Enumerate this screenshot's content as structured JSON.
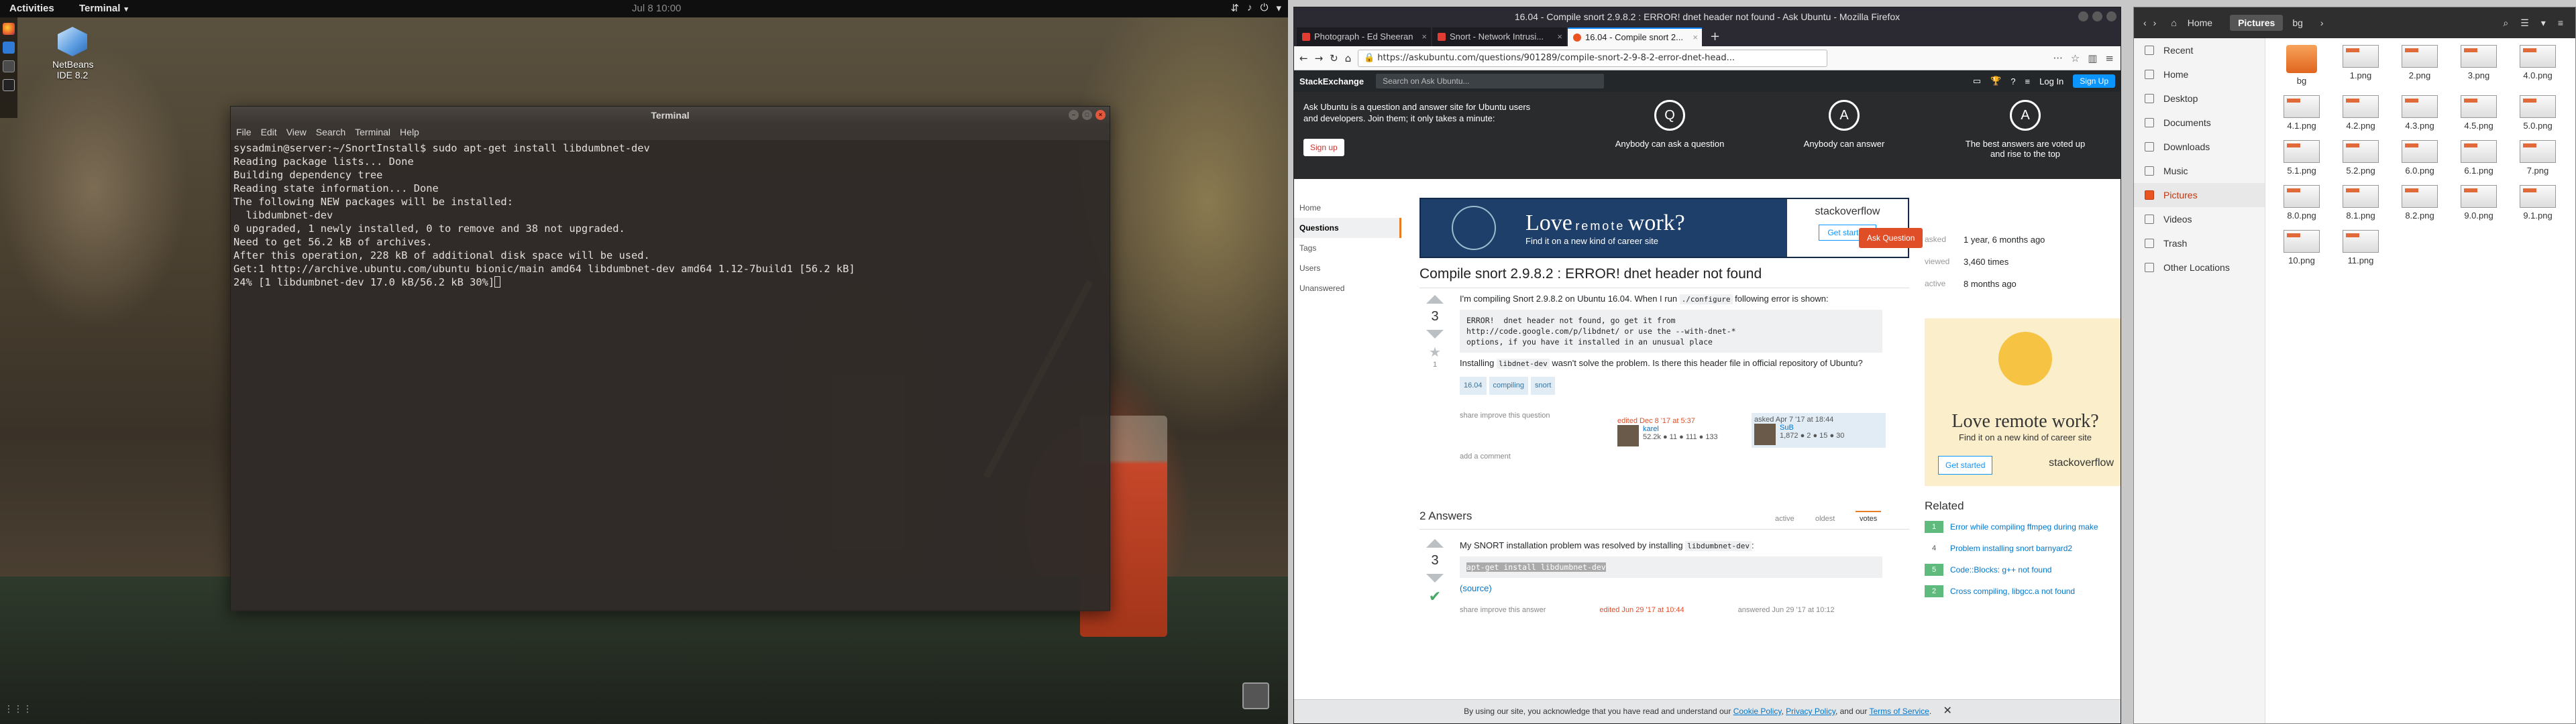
{
  "topbar": {
    "activities": "Activities",
    "app": "Terminal",
    "clock": "Jul 8 10:00"
  },
  "desktop": {
    "icon_label_line1": "NetBeans",
    "icon_label_line2": "IDE 8.2"
  },
  "terminal": {
    "title": "Terminal",
    "menu": [
      "File",
      "Edit",
      "View",
      "Search",
      "Terminal",
      "Help"
    ],
    "lines": [
      "sysadmin@server:~/SnortInstall$ sudo apt-get install libdumbnet-dev",
      "Reading package lists... Done",
      "Building dependency tree",
      "Reading state information... Done",
      "The following NEW packages will be installed:",
      "  libdumbnet-dev",
      "0 upgraded, 1 newly installed, 0 to remove and 38 not upgraded.",
      "Need to get 56.2 kB of archives.",
      "After this operation, 228 kB of additional disk space will be used.",
      "Get:1 http://archive.ubuntu.com/ubuntu bionic/main amd64 libdumbnet-dev amd64 1.12-7build1 [56.2 kB]",
      "24% [1 libdumbnet-dev 17.0 kB/56.2 kB 30%]"
    ]
  },
  "firefox": {
    "window_title": "16.04 - Compile snort 2.9.8.2 : ERROR! dnet header not found - Ask Ubuntu - Mozilla Firefox",
    "tabs": [
      {
        "label": "Photograph - Ed Sheeran",
        "color": "#e03c31"
      },
      {
        "label": "Snort - Network Intrusi...",
        "color": "#e03c31"
      },
      {
        "label": "16.04 - Compile snort 2...",
        "color": "#e95420"
      }
    ],
    "url": "https://askubuntu.com/questions/901289/compile-snort-2-9-8-2-error-dnet-head...",
    "se": {
      "logo": "StackExchange",
      "search_placeholder": "Search on Ask Ubuntu...",
      "login": "Log In",
      "signup": "Sign Up"
    },
    "hero": {
      "pitch": "Ask Ubuntu is a question and answer site for Ubuntu users and developers. Join them; it only takes a minute:",
      "signup": "Sign up",
      "feat1": "Anybody can ask a question",
      "feat2": "Anybody can answer",
      "feat3": "The best answers are voted up and rise to the top"
    },
    "leftnav": [
      "Home",
      "Questions",
      "Tags",
      "Users",
      "Unanswered"
    ],
    "ad": {
      "headline_a": "Love",
      "headline_b": "remote",
      "headline_c": "work?",
      "sub": "Find it on a new kind of career site",
      "brand": "stackoverflow",
      "cta": "Get started"
    },
    "question": {
      "title": "Compile snort 2.9.8.2 : ERROR! dnet header not found",
      "ask": "Ask Question",
      "votes": "3",
      "fav_count": "1",
      "body_pre": "I'm compiling Snort 2.9.8.2 on Ubuntu 16.04. When I run",
      "body_code": "./configure",
      "body_post": "following error is shown:",
      "error": "ERROR!  dnet header not found, go get it from\nhttp://code.google.com/p/libdnet/ or use the --with-dnet-*\noptions, if you have it installed in an unusual place",
      "body2_pre": "Installing",
      "body2_code": "libdnet-dev",
      "body2_post": "wasn't solve the problem. Is there this header file in official repository of Ubuntu?",
      "tags": [
        "16.04",
        "compiling",
        "snort"
      ],
      "share": "share  improve this question",
      "edited": "edited Dec 8 '17 at 5:37",
      "editor": "karel",
      "editor_rep": "52.2k  ● 11  ● 111  ● 133",
      "asked": "asked Apr 7 '17 at 18:44",
      "asker": "SuB",
      "asker_rep": "1,872  ● 2  ● 15  ● 30",
      "comment": "add a comment"
    },
    "stats": [
      {
        "k": "asked",
        "v": "1 year, 6 months ago"
      },
      {
        "k": "viewed",
        "v": "3,460 times"
      },
      {
        "k": "active",
        "v": "8 months ago"
      }
    ],
    "answers": {
      "count": "2 Answers",
      "sort": [
        "active",
        "oldest",
        "votes"
      ],
      "a1_pre": "My SNORT installation problem was resolved by installing",
      "a1_code": "libdumbnet-dev",
      "a1_cmd": "apt-get install libdumbnet-dev",
      "a1_source": "(source)",
      "a1_votes": "3",
      "a1_share": "share  improve this answer",
      "a1_edited": "edited Jun 29 '17 at 10:44",
      "a1_answered": "answered Jun 29 '17 at 10:12"
    },
    "side_ad": {
      "headline": "Love remote work?",
      "sub": "Find it on a new kind of career site",
      "cta": "Get started",
      "brand": "stackoverflow"
    },
    "related": {
      "title": "Related",
      "items": [
        {
          "c": "1",
          "t": "Error while compiling ffmpeg during make",
          "pos": true
        },
        {
          "c": "4",
          "t": "Problem installing snort barnyard2",
          "pos": false
        },
        {
          "c": "5",
          "t": "Code::Blocks: g++ not found",
          "pos": true
        },
        {
          "c": "2",
          "t": "Cross compiling, libgcc.a not found",
          "pos": true
        }
      ]
    },
    "cookie": {
      "pre": "By using our site, you acknowledge that you have read and understand our",
      "l1": "Cookie Policy",
      "l2": "Privacy Policy",
      "mid": ", and our",
      "l3": "Terms of Service"
    }
  },
  "files": {
    "crumbs": [
      "Home",
      "Pictures",
      "bg"
    ],
    "sidebar": [
      {
        "label": "Recent"
      },
      {
        "label": "Home"
      },
      {
        "label": "Desktop"
      },
      {
        "label": "Documents"
      },
      {
        "label": "Downloads"
      },
      {
        "label": "Music"
      },
      {
        "label": "Pictures",
        "selected": true
      },
      {
        "label": "Videos"
      },
      {
        "label": "Trash"
      },
      {
        "label": "Other Locations"
      }
    ],
    "items": [
      "bg",
      "1.png",
      "2.png",
      "3.png",
      "4.0.png",
      "4.1.png",
      "4.2.png",
      "4.3.png",
      "4.5.png",
      "5.0.png",
      "5.1.png",
      "5.2.png",
      "6.0.png",
      "6.1.png",
      "7.png",
      "8.0.png",
      "8.1.png",
      "8.2.png",
      "9.0.png",
      "9.1.png",
      "10.png",
      "11.png"
    ]
  }
}
